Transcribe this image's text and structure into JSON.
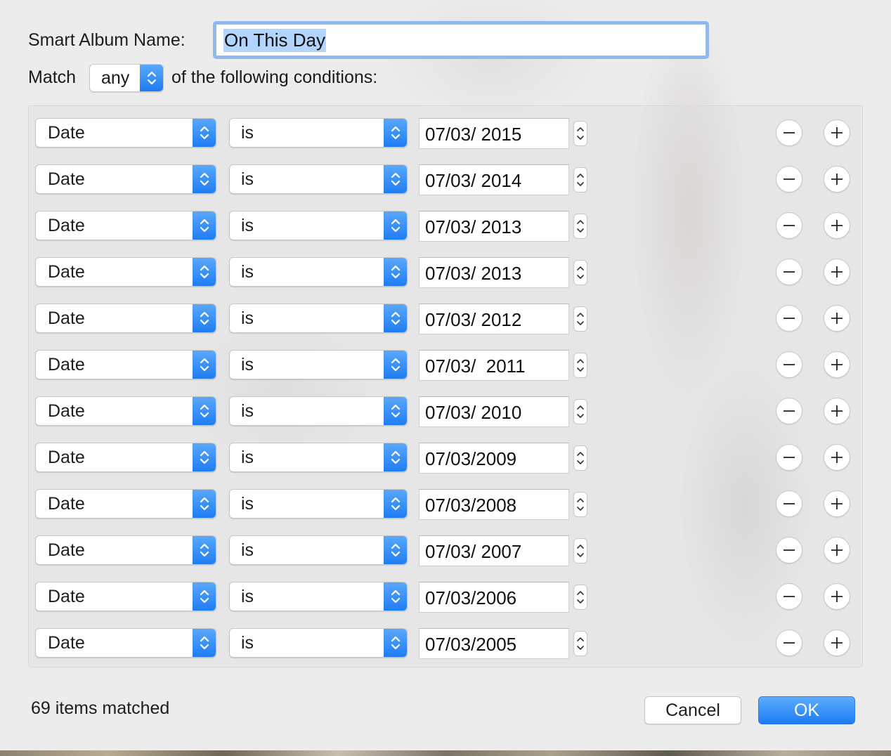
{
  "header": {
    "name_label": "Smart Album Name:",
    "name_value": "On This Day",
    "match_label": "Match",
    "match_value": "any",
    "match_suffix": "of the following conditions:"
  },
  "conditions": [
    {
      "field": "Date",
      "operator": "is",
      "value": "07/03/ 2015"
    },
    {
      "field": "Date",
      "operator": "is",
      "value": "07/03/ 2014"
    },
    {
      "field": "Date",
      "operator": "is",
      "value": "07/03/ 2013"
    },
    {
      "field": "Date",
      "operator": "is",
      "value": "07/03/ 2013"
    },
    {
      "field": "Date",
      "operator": "is",
      "value": "07/03/ 2012"
    },
    {
      "field": "Date",
      "operator": "is",
      "value": "07/03/  2011"
    },
    {
      "field": "Date",
      "operator": "is",
      "value": "07/03/ 2010"
    },
    {
      "field": "Date",
      "operator": "is",
      "value": "07/03/2009"
    },
    {
      "field": "Date",
      "operator": "is",
      "value": "07/03/2008"
    },
    {
      "field": "Date",
      "operator": "is",
      "value": "07/03/ 2007"
    },
    {
      "field": "Date",
      "operator": "is",
      "value": "07/03/2006"
    },
    {
      "field": "Date",
      "operator": "is",
      "value": "07/03/2005"
    }
  ],
  "footer": {
    "status": "69 items matched",
    "cancel_label": "Cancel",
    "ok_label": "OK"
  },
  "colors": {
    "accent": "#1f7cf2",
    "selection": "#b3d4fd",
    "focus_ring": "#8fb9ec"
  },
  "icons": {
    "popup": "chevron-up-down-icon",
    "stepper": "stepper-arrows-icon",
    "remove": "minus-icon",
    "add": "plus-icon"
  }
}
